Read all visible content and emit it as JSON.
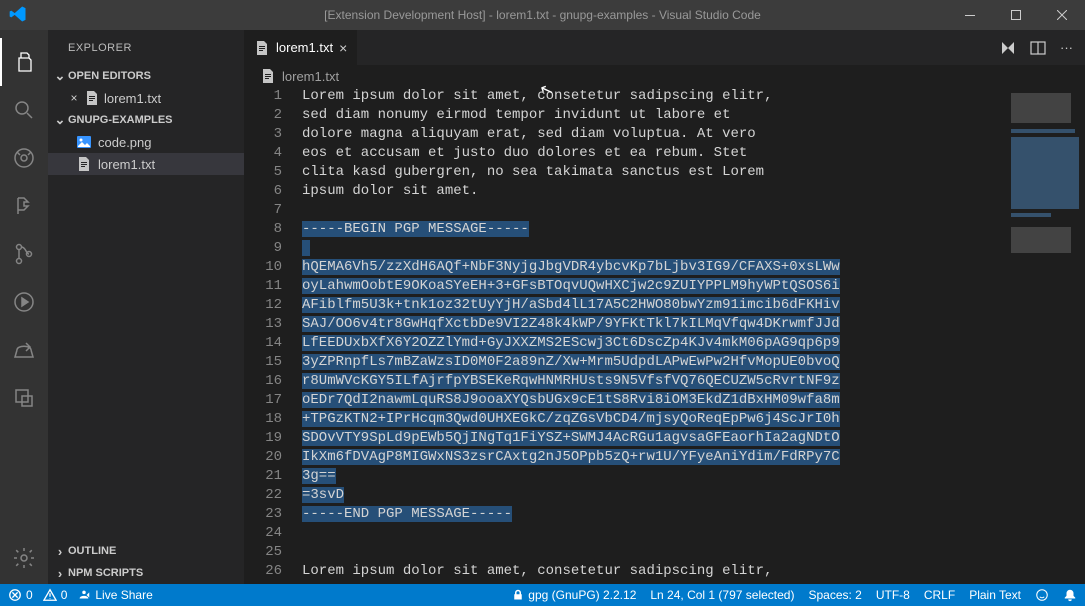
{
  "title": "[Extension Development Host] - lorem1.txt - gnupg-examples - Visual Studio Code",
  "sidebar": {
    "title": "EXPLORER",
    "openEditors": {
      "label": "OPEN EDITORS",
      "items": [
        {
          "name": "lorem1.txt"
        }
      ]
    },
    "workspace": {
      "label": "GNUPG-EXAMPLES",
      "items": [
        {
          "name": "code.png",
          "type": "image"
        },
        {
          "name": "lorem1.txt",
          "type": "text",
          "selected": true
        }
      ]
    },
    "outline": {
      "label": "OUTLINE"
    },
    "npm": {
      "label": "NPM SCRIPTS"
    }
  },
  "tab": {
    "label": "lorem1.txt"
  },
  "breadcrumb": {
    "label": "lorem1.txt"
  },
  "lines": [
    "Lorem ipsum dolor sit amet, consetetur sadipscing elitr,",
    "sed diam nonumy eirmod tempor invidunt ut labore et",
    "dolore magna aliquyam erat, sed diam voluptua. At vero",
    "eos et accusam et justo duo dolores et ea rebum. Stet",
    "clita kasd gubergren, no sea takimata sanctus est Lorem",
    "ipsum dolor sit amet.",
    "",
    "-----BEGIN PGP MESSAGE-----",
    "",
    "hQEMA6Vh5/zzXdH6AQf+NbF3NyjgJbgVDR4ybcvKp7bLjbv3IG9/CFAXS+0xsLWw",
    "oyLahwmOobtE9OKoaSYeEH+3+GFsBTOqvUQwHXCjw2c9ZUIYPPLM9hyWPtQSOS6i",
    "AFiblfm5U3k+tnk1oz32tUyYjH/aSbd4lL17A5C2HWO80bwYzm91imcib6dFKHiv",
    "SAJ/OO6v4tr8GwHqfXctbDe9VI2Z48k4kWP/9YFKtTkl7kILMqVfqw4DKrwmfJJd",
    "LfEEDUxbXfX6Y2OZZlYmd+GyJXXZMS2EScwj3Ct6DscZp4KJv4mkM06pAG9qp6p9",
    "3yZPRnpfLs7mBZaWzsID0M0F2a89nZ/Xw+Mrm5UdpdLAPwEwPw2HfvMopUE0bvoQ",
    "r8UmWVcKGY5ILfAjrfpYBSEKeRqwHNMRHUsts9N5VfsfVQ76QECUZW5cRvrtNF9z",
    "oEDr7QdI2nawmLquRS8J9ooaXYQsbUGx9cE1tS8Rvi8iOM3EkdZ1dBxHM09wfa8m",
    "+TPGzKTN2+IPrHcqm3Qwd0UHXEGkC/zqZGsVbCD4/mjsyQoReqEpPw6j4ScJrI0h",
    "SDOvVTY9SpLd9pEWb5QjINgTq1FiYSZ+SWMJ4AcRGu1agvsaGFEaorhIa2agNDtO",
    "IkXm6fDVAgP8MIGWxNS3zsrCAxtg2nJ5OPpb5zQ+rw1U/YFyeAniYdim/FdRPy7C",
    "3g==",
    "=3svD",
    "-----END PGP MESSAGE-----",
    "",
    "",
    "Lorem ipsum dolor sit amet, consetetur sadipscing elitr,"
  ],
  "selection": {
    "start": 8,
    "end": 23
  },
  "status": {
    "errors": "0",
    "warnings": "0",
    "liveShare": "Live Share",
    "gpg": "gpg (GnuPG) 2.2.12",
    "lnCol": "Ln 24, Col 1 (797 selected)",
    "spaces": "Spaces: 2",
    "encoding": "UTF-8",
    "eol": "CRLF",
    "lang": "Plain Text"
  }
}
